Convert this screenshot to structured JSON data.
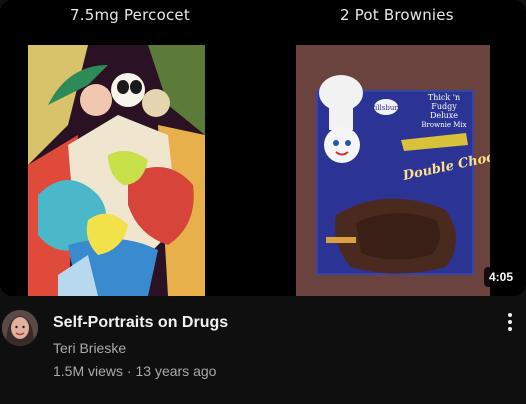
{
  "thumbnail": {
    "caption_left": "7.5mg Percocet",
    "caption_right": "2 Pot Brownies",
    "duration": "4:05",
    "box_text": {
      "brand": "Pillsbury",
      "tagline_1": "Thick 'n",
      "tagline_2": "Fudgy",
      "tagline_3": "Deluxe",
      "tagline_4": "Brownie Mix",
      "product": "Double Chocolate"
    }
  },
  "video": {
    "title": "Self-Portraits on Drugs",
    "channel": "Teri Brieske",
    "views": "1.5M views",
    "separator": "·",
    "age": "13 years ago"
  },
  "colors": {
    "background": "#0f0f0f",
    "title_text": "#f1f1f1",
    "secondary_text": "#aaaaaa"
  },
  "icons": {
    "menu": "more-vert-icon"
  }
}
